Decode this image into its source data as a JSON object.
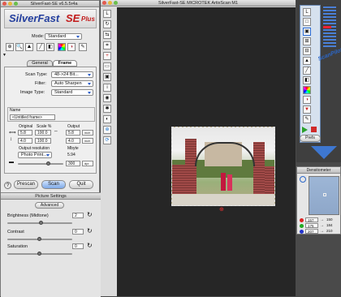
{
  "left_window": {
    "title": "SilverFast-SE v6.5.5r4a",
    "logo_main": "SilverFast",
    "logo_sub": "SE",
    "logo_plus": "Plus",
    "mode_label": "Mode:",
    "mode_value": "Standard",
    "tabs": [
      "General",
      "Frame"
    ],
    "scan_type_label": "Scan Type:",
    "scan_type_value": "48->24 Bit...",
    "filter_label": "Filter:",
    "filter_value": "Auto Sharpen",
    "image_type_label": "Image Type:",
    "image_type_value": "Standard",
    "name_label": "Name",
    "name_value": "<Untitled frame>",
    "original_label": "Original",
    "scale_label": "Scale %",
    "output_label": "Output",
    "orig_w": "5.8",
    "orig_h": "4.0",
    "scale_w": "100.0",
    "scale_h": "100.0",
    "out_w": "5.8",
    "out_h": "4.0",
    "unit": "inch",
    "resolution_label": "Output resolution",
    "mbyte_label": "Mbyte",
    "resolution_value": "Photo Print...",
    "mbyte_value": "5.94",
    "dpi_value": "300",
    "dpi_unit": "dpi",
    "prescan": "Prescan",
    "scan": "Scan",
    "quit": "Quit"
  },
  "picture_settings": {
    "title": "Picture Settings",
    "advanced": "Advanced",
    "brightness_label": "Brightness (Midtone)",
    "brightness_value": "2",
    "contrast_label": "Contrast",
    "contrast_value": "0",
    "saturation_label": "Saturation",
    "saturation_value": "0",
    "brightness_level": 0.52,
    "contrast_level": 0.5,
    "saturation_level": 0.5
  },
  "preview_window": {
    "title": "SilverFast-SE MICROTEK ArtixScan M1"
  },
  "scanpilot": {
    "title": "ScanPilot",
    "prefs": "Prefs"
  },
  "densitometer": {
    "title": "Densitometer",
    "rows": [
      {
        "in": "157",
        "out": "150"
      },
      {
        "in": "175",
        "out": "184"
      },
      {
        "in": "207",
        "out": "210"
      }
    ]
  }
}
